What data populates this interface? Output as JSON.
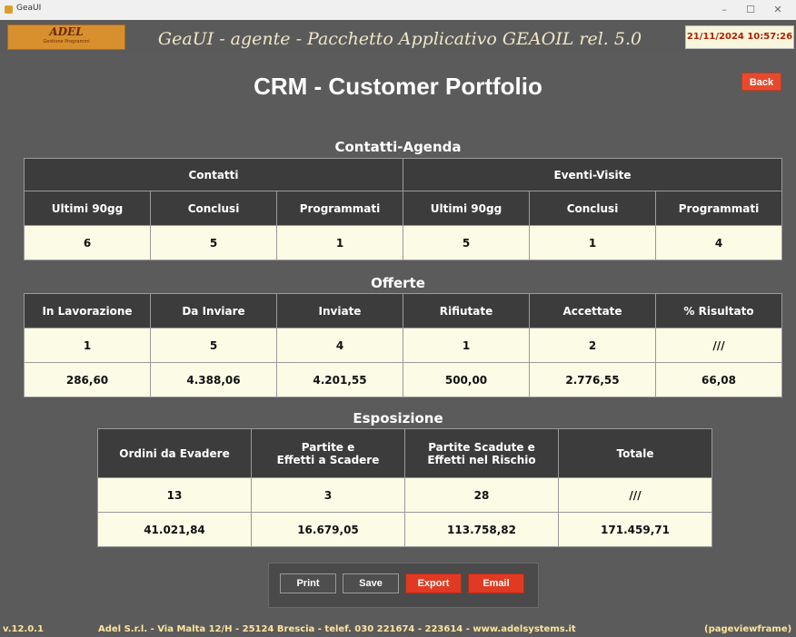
{
  "window": {
    "title": "GeaUI"
  },
  "header": {
    "logo_text": "ADEL",
    "logo_subtext": "Gestione Programmi",
    "app_title": "GeaUI - agente - Pacchetto Applicativo GEAOIL rel. 5.0",
    "datetime": "21/11/2024 10:57:26"
  },
  "page": {
    "title": "CRM - Customer Portfolio",
    "back_label": "Back"
  },
  "contatti": {
    "section_title": "Contatti-Agenda",
    "group_contatti": "Contatti",
    "group_eventi": "Eventi-Visite",
    "headers": [
      "Ultimi 90gg",
      "Conclusi",
      "Programmati",
      "Ultimi 90gg",
      "Conclusi",
      "Programmati"
    ],
    "values": [
      "6",
      "5",
      "1",
      "5",
      "1",
      "4"
    ]
  },
  "offerte": {
    "section_title": "Offerte",
    "headers": [
      "In Lavorazione",
      "Da Inviare",
      "Inviate",
      "Rifiutate",
      "Accettate",
      "% Risultato"
    ],
    "counts": [
      "1",
      "5",
      "4",
      "1",
      "2",
      "///"
    ],
    "amounts": [
      "286,60",
      "4.388,06",
      "4.201,55",
      "500,00",
      "2.776,55",
      "66,08"
    ]
  },
  "esposizione": {
    "section_title": "Esposizione",
    "h1": "Ordini da Evadere",
    "h2a": "Partite e",
    "h2b": "Effetti a Scadere",
    "h3a": "Partite Scadute e",
    "h3b": "Effetti nel Rischio",
    "h4": "Totale",
    "counts": [
      "13",
      "3",
      "28",
      "///"
    ],
    "amounts": [
      "41.021,84",
      "16.679,05",
      "113.758,82",
      "171.459,71"
    ]
  },
  "buttons": {
    "print": "Print",
    "save": "Save",
    "export": "Export",
    "email": "Email"
  },
  "status": {
    "version": "v.12.0.1",
    "company": "Adel S.r.l. - Via Malta 12/H - 25124 Brescia - telef. 030 221674 - 223614 - www.adelsystems.it",
    "frame": "(pageviewframe)"
  },
  "colors": {
    "accent_red": "#e64a2e",
    "header_bg": "#3c3c3c",
    "value_bg": "#fbfbe6",
    "datetime_text": "#b02000"
  }
}
